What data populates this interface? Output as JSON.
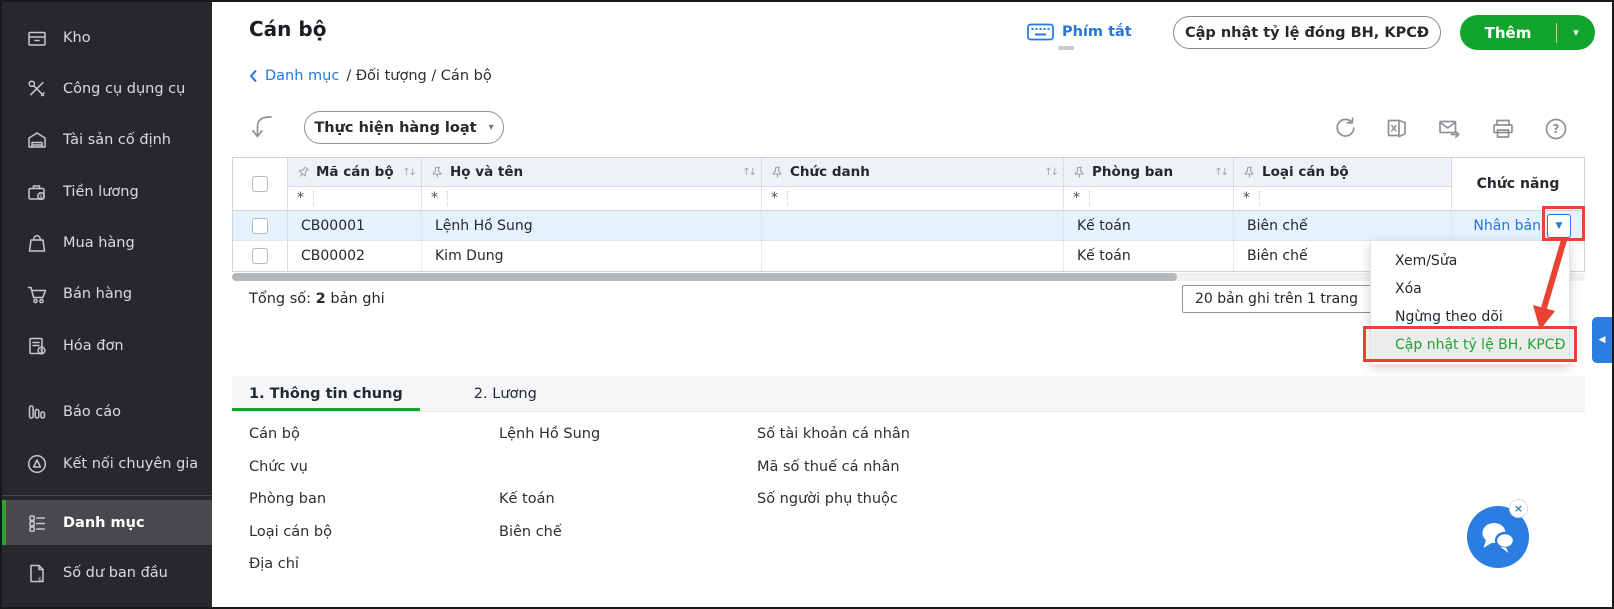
{
  "sidebar": {
    "items": [
      {
        "label": "Kho",
        "icon": "warehouse-icon"
      },
      {
        "label": "Công cụ dụng cụ",
        "icon": "tools-icon"
      },
      {
        "label": "Tài sản cố định",
        "icon": "fixed-asset-icon"
      },
      {
        "label": "Tiền lương",
        "icon": "salary-icon"
      },
      {
        "label": "Mua hàng",
        "icon": "purchase-icon"
      },
      {
        "label": "Bán hàng",
        "icon": "sales-cart-icon"
      },
      {
        "label": "Hóa đơn",
        "icon": "invoice-icon"
      },
      {
        "label": "Báo cáo",
        "icon": "report-icon"
      },
      {
        "label": "Kết nối chuyên gia",
        "icon": "expert-connect-icon"
      },
      {
        "label": "Danh mục",
        "icon": "category-icon",
        "active": true
      },
      {
        "label": "Số dư ban đầu",
        "icon": "opening-balance-icon"
      }
    ]
  },
  "header": {
    "title": "Cán bộ",
    "breadcrumb": {
      "back": "Danh mục",
      "path": "/ Đối tượng / Cán bộ"
    },
    "shortcut_label": "Phím tắt",
    "update_rate_button": "Cập nhật tỷ lệ đóng BH, KPCĐ",
    "add_button": "Thêm"
  },
  "toolbar": {
    "batch_button": "Thực hiện hàng loạt"
  },
  "table": {
    "columns": [
      "Mã cán bộ",
      "Họ và tên",
      "Chức danh",
      "Phòng ban",
      "Loại cán bộ"
    ],
    "function_column": "Chức năng",
    "filter_placeholder": "*",
    "rows": [
      {
        "code": "CB00001",
        "name": "Lệnh Hồ Sung",
        "title": "",
        "department": "Kế toán",
        "type": "Biên chế",
        "action_label": "Nhân bản",
        "selected": true
      },
      {
        "code": "CB00002",
        "name": "Kim Dung",
        "title": "",
        "department": "Kế toán",
        "type": "Biên chế",
        "action_label": ""
      }
    ],
    "total_label": "Tổng số:",
    "total_count": "2",
    "total_suffix": "bản ghi",
    "page_size": "20 bản ghi trên 1 trang"
  },
  "context_menu": {
    "items": [
      "Xem/Sửa",
      "Xóa",
      "Ngừng theo dõi"
    ],
    "highlighted_item": "Cập nhật tỷ lệ BH, KPCĐ"
  },
  "tabs": [
    {
      "label": "1. Thông tin chung",
      "active": true
    },
    {
      "label": "2. Lương"
    }
  ],
  "details": {
    "rows": [
      {
        "label": "Cán bộ",
        "value": "Lệnh Hồ Sung",
        "right_label": "Số tài khoản cá nhân"
      },
      {
        "label": "Chức vụ",
        "value": "",
        "right_label": "Mã số thuế cá nhân"
      },
      {
        "label": "Phòng ban",
        "value": "Kế toán",
        "right_label": "Số người phụ thuộc"
      },
      {
        "label": "Loại cán bộ",
        "value": "Biên chế",
        "right_label": ""
      },
      {
        "label": "Địa chỉ",
        "value": "",
        "right_label": ""
      }
    ]
  },
  "icons": {
    "close": "×",
    "dropdown_arrow": "▼",
    "collapse_arrow": "◀",
    "chevron_small": "▾",
    "sort": "↑↓"
  },
  "colors": {
    "accent_green": "#12a52e",
    "accent_blue": "#2377de",
    "annotation_red": "#e94235",
    "sidebar_bg": "#26282c",
    "row_highlight": "#e5f1fb",
    "header_bg": "#eef1f6"
  }
}
